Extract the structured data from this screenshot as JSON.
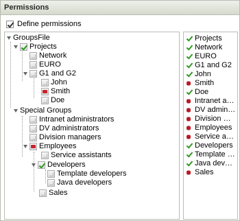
{
  "panel": {
    "title": "Permissions"
  },
  "define_permissions": {
    "label": "Define permissions",
    "checked": true
  },
  "tree": {
    "root": "GroupsFile",
    "projects": "Projects",
    "network": "Network",
    "euro": "EURO",
    "g1g2": "G1 and G2",
    "john": "John",
    "smith": "Smith",
    "doe": "Doe",
    "special": "Special Groups",
    "intranet": "Intranet administrators",
    "dv": "DV administrators",
    "division": "Division managers",
    "employees": "Employees",
    "service": "Service assistants",
    "developers": "Developers",
    "template": "Template developers",
    "java": "Java developers",
    "sales": "Sales"
  },
  "list": [
    {
      "label": "Projects",
      "state": "allow"
    },
    {
      "label": "Network",
      "state": "allow"
    },
    {
      "label": "EURO",
      "state": "allow"
    },
    {
      "label": "G1 and G2",
      "state": "allow"
    },
    {
      "label": "John",
      "state": "allow"
    },
    {
      "label": "Smith",
      "state": "deny"
    },
    {
      "label": "Doe",
      "state": "allow"
    },
    {
      "label": "Intranet administrators",
      "state": "deny"
    },
    {
      "label": "DV administrators",
      "state": "deny"
    },
    {
      "label": "Division managers",
      "state": "deny"
    },
    {
      "label": "Employees",
      "state": "deny"
    },
    {
      "label": "Service assistants",
      "state": "deny"
    },
    {
      "label": "Developers",
      "state": "allow"
    },
    {
      "label": "Template developers",
      "state": "allow"
    },
    {
      "label": "Java developers",
      "state": "allow"
    },
    {
      "label": "Sales",
      "state": "deny"
    }
  ]
}
